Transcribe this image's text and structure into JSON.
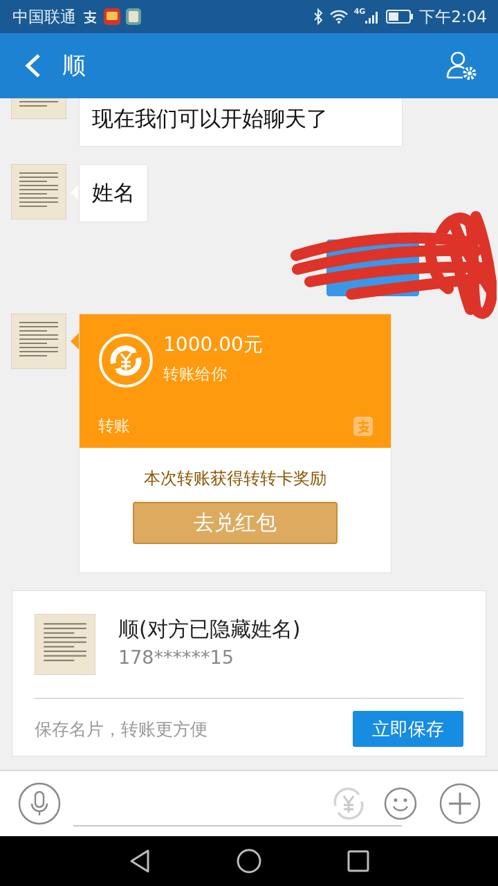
{
  "status_bar": {
    "carrier": "中国联通",
    "network_type": "4G",
    "time": "下午2:04"
  },
  "header": {
    "title": "顺"
  },
  "messages": [
    {
      "kind": "text",
      "outgoing": false,
      "text": "现在我们可以开始聊天了"
    },
    {
      "kind": "text",
      "outgoing": false,
      "text": "姓名"
    },
    {
      "kind": "redacted",
      "outgoing": true
    },
    {
      "kind": "transfer",
      "outgoing": false,
      "amount": "1000.00元",
      "caption": "转账给你",
      "label": "转账",
      "reward_text": "本次转账获得转转卡奖励",
      "reward_button": "去兑红包"
    }
  ],
  "contact_card": {
    "name": "顺(对方已隐藏姓名)",
    "phone": "178******15",
    "hint": "保存名片，转账更方便",
    "save_button": "立即保存"
  }
}
